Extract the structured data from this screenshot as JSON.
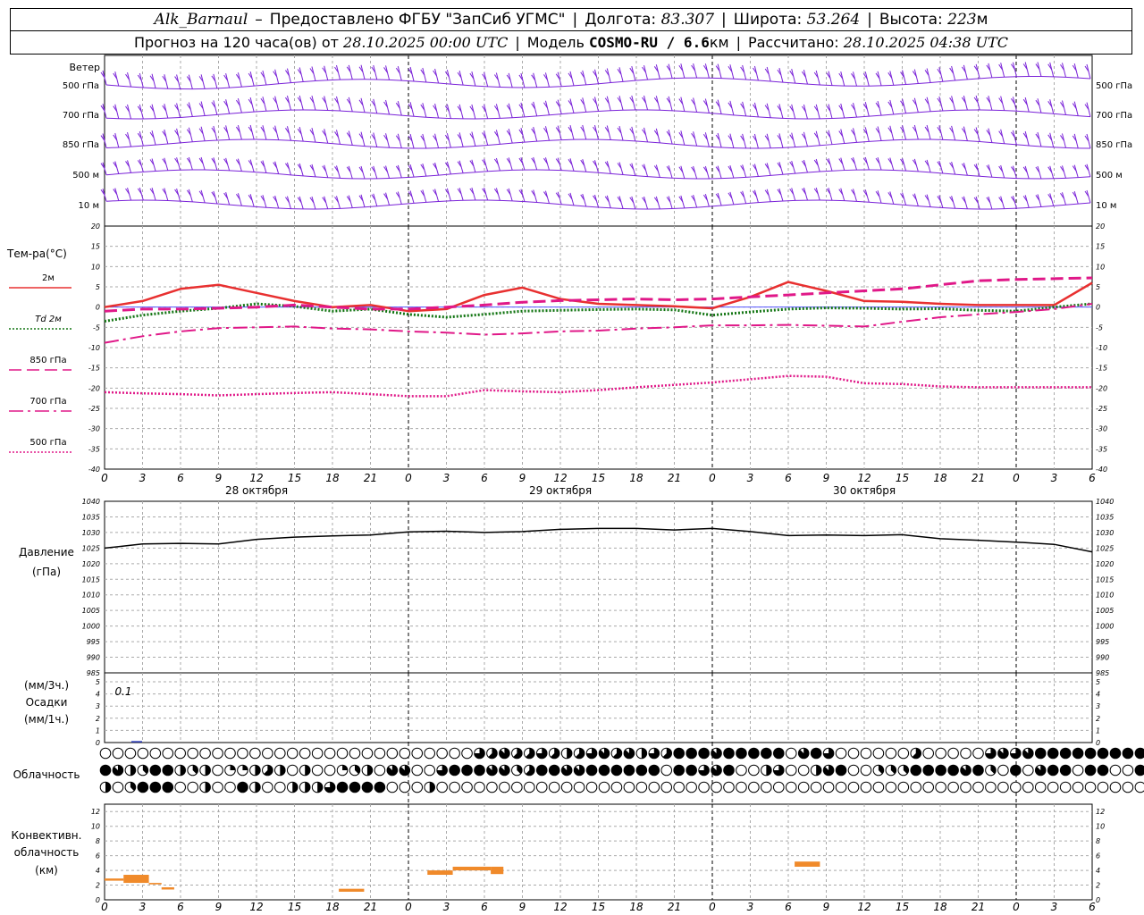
{
  "header": {
    "station": "Alk_Barnaul",
    "dash": "–",
    "provider": "Предоставлено ФГБУ \"ЗапСиб УГМС\"",
    "lon_label": "Долгота:",
    "lon": "83.307",
    "lat_label": "Широта:",
    "lat": "53.264",
    "alt_label": "Высота:",
    "alt": "223",
    "alt_unit": "м"
  },
  "subheader": {
    "forecast_label": "Прогноз на 120 часа(ов) от",
    "init_time": "28.10.2025 00:00 UTC",
    "model_label": "Модель",
    "model": "COSMO-RU / 6.6",
    "model_unit": "км",
    "computed_label": "Рассчитано:",
    "computed_time": "28.10.2025 04:38 UTC"
  },
  "labels": {
    "wind": "Ветер",
    "wind_levels": [
      "500 гПа",
      "700 гПа",
      "850 гПа",
      "500 м",
      "10 м"
    ],
    "temp_title": "Тем-ра(°C)",
    "legend": [
      "2м",
      "Td 2м",
      "850 гПа",
      "700 гПа",
      "500 гПа"
    ],
    "pressure_title": "Давление",
    "pressure_unit": "(гПа)",
    "precip_3h": "(мм/3ч.)",
    "precip_title": "Осадки",
    "precip_1h": "(мм/1ч.)",
    "precip_max": "0.1",
    "cloud_title": "Облачность",
    "conv_title": "Конвективн.",
    "conv_title2": "облачность",
    "conv_unit": "(км)"
  },
  "colors": {
    "t2m": "#e83030",
    "td2m": "#127512",
    "t850": "#e01888",
    "t700": "#e01888",
    "t500": "#e01888",
    "wind": "#7a22d8",
    "pressure": "#000000",
    "convective": "#f08a2a"
  },
  "chart_data": [
    {
      "type": "line",
      "name": "temperature",
      "x_hours": [
        0,
        3,
        6,
        9,
        12,
        15,
        18,
        21,
        24,
        27,
        30,
        33,
        36,
        39,
        42,
        45,
        48,
        51,
        54,
        57,
        60,
        63,
        66,
        69,
        72,
        75,
        78
      ],
      "x_tick_labels": [
        "0",
        "3",
        "6",
        "9",
        "12",
        "15",
        "18",
        "21",
        "0",
        "3",
        "6",
        "9",
        "12",
        "15",
        "18",
        "21",
        "0",
        "3",
        "6",
        "9",
        "12",
        "15",
        "18",
        "21",
        "0",
        "3",
        "6"
      ],
      "day_labels": [
        "28 октября",
        "29 октября",
        "30 октября"
      ],
      "ylim": [
        -40,
        20
      ],
      "yticks": [
        20,
        15,
        10,
        5,
        0,
        -5,
        -10,
        -15,
        -20,
        -25,
        -30,
        -35,
        -40
      ],
      "series": [
        {
          "name": "2м",
          "values": [
            0,
            1.5,
            4.5,
            5.5,
            3.5,
            1.5,
            0,
            0.5,
            -1,
            -0.5,
            3,
            4.8,
            2,
            0.8,
            0.5,
            0.2,
            -0.3,
            2.5,
            6.2,
            4,
            1.5,
            1.3,
            0.8,
            0.5,
            0.5,
            0.5,
            6
          ]
        },
        {
          "name": "Td 2м",
          "values": [
            -3.5,
            -2,
            -1,
            -0.3,
            0.8,
            0.2,
            -1,
            -0.5,
            -1.8,
            -2.5,
            -1.8,
            -1,
            -0.8,
            -0.6,
            -0.5,
            -0.7,
            -2,
            -1.2,
            -0.5,
            -0.2,
            -0.3,
            -0.5,
            -0.4,
            -0.8,
            -1,
            0,
            0.8
          ]
        },
        {
          "name": "850 гПа",
          "values": [
            -1,
            -0.5,
            -0.5,
            -0.3,
            0,
            0.5,
            0,
            -0.5,
            -0.5,
            0,
            0.5,
            1.2,
            1.6,
            1.8,
            2,
            1.8,
            2,
            2.5,
            3,
            3.5,
            4,
            4.5,
            5.5,
            6.5,
            6.8,
            7,
            7.2
          ]
        },
        {
          "name": "700 гПа",
          "values": [
            -8.8,
            -7.2,
            -6,
            -5.2,
            -5,
            -4.8,
            -5.3,
            -5.5,
            -6,
            -6.3,
            -6.8,
            -6.5,
            -6,
            -5.8,
            -5.3,
            -5,
            -4.5,
            -4.5,
            -4.4,
            -4.6,
            -4.8,
            -3.6,
            -2.5,
            -1.8,
            -1.2,
            -0.5,
            0.8
          ]
        },
        {
          "name": "500 гПа",
          "values": [
            -21,
            -21.3,
            -21.5,
            -21.8,
            -21.5,
            -21.2,
            -21,
            -21.5,
            -22,
            -22,
            -20.5,
            -20.8,
            -21,
            -20.5,
            -19.8,
            -19.2,
            -18.6,
            -17.8,
            -17,
            -17.2,
            -18.8,
            -19,
            -19.6,
            -19.8,
            -19.8,
            -19.8,
            -19.8
          ]
        }
      ]
    },
    {
      "type": "line",
      "name": "pressure",
      "x_hours": [
        0,
        3,
        6,
        9,
        12,
        15,
        18,
        21,
        24,
        27,
        30,
        33,
        36,
        39,
        42,
        45,
        48,
        51,
        54,
        57,
        60,
        63,
        66,
        69,
        72,
        75,
        78
      ],
      "ylim": [
        985,
        1040
      ],
      "yticks": [
        1040,
        1035,
        1030,
        1025,
        1020,
        1015,
        1010,
        1005,
        1000,
        995,
        990,
        985
      ],
      "series": [
        {
          "name": "Давление",
          "values": [
            1025,
            1026.3,
            1026.5,
            1026.3,
            1027.8,
            1028.5,
            1028.9,
            1029.2,
            1030.2,
            1030.4,
            1030,
            1030.3,
            1031,
            1031.3,
            1031.3,
            1030.8,
            1031.3,
            1030.3,
            1029,
            1029.2,
            1029,
            1029.3,
            1028,
            1027.5,
            1026.9,
            1026.2,
            1023.8
          ]
        }
      ]
    },
    {
      "type": "bar",
      "name": "precipitation",
      "ylim": [
        0,
        5
      ],
      "yticks": [
        5,
        4,
        3,
        2,
        1,
        0
      ],
      "values": [
        0.05,
        0,
        0,
        0,
        0,
        0,
        0,
        0,
        0,
        0,
        0,
        0,
        0,
        0,
        0,
        0,
        0,
        0,
        0,
        0,
        0,
        0,
        0,
        0,
        0,
        0,
        0
      ]
    },
    {
      "type": "table",
      "name": "cloudiness",
      "note": "cloud cover per hour in oktas, three rows, 80 hourly symbols",
      "rows": [
        "000000000000000000000000000000657556545675746588878888807860000005000006767888888888886765",
        "874388434022454040023407700688877358877888888088678004600478003338888783080788088008860003",
        "403888004008400444688880004000000000000000000000000000000000000000000000000000000000000000"
      ]
    },
    {
      "type": "bar",
      "name": "convective_cloudiness",
      "ylim": [
        0,
        13
      ],
      "yticks": [
        12,
        10,
        8,
        6,
        4,
        2,
        0
      ],
      "segments": [
        {
          "from_hour": 0,
          "to_hour": 1.5,
          "bottom": 2.6,
          "top": 2.9
        },
        {
          "from_hour": 1.5,
          "to_hour": 3.5,
          "bottom": 2.3,
          "top": 3.4
        },
        {
          "from_hour": 3.5,
          "to_hour": 4.5,
          "bottom": 2.1,
          "top": 2.3
        },
        {
          "from_hour": 4.5,
          "to_hour": 5.5,
          "bottom": 1.4,
          "top": 1.7
        },
        {
          "from_hour": 18.5,
          "to_hour": 20.5,
          "bottom": 1.1,
          "top": 1.5
        },
        {
          "from_hour": 25.5,
          "to_hour": 27.5,
          "bottom": 3.4,
          "top": 4.0
        },
        {
          "from_hour": 27.5,
          "to_hour": 30.5,
          "bottom": 4.0,
          "top": 4.5
        },
        {
          "from_hour": 30.5,
          "to_hour": 31.5,
          "bottom": 3.5,
          "top": 4.5
        },
        {
          "from_hour": 54.5,
          "to_hour": 56.5,
          "bottom": 4.5,
          "top": 5.2
        }
      ]
    }
  ]
}
